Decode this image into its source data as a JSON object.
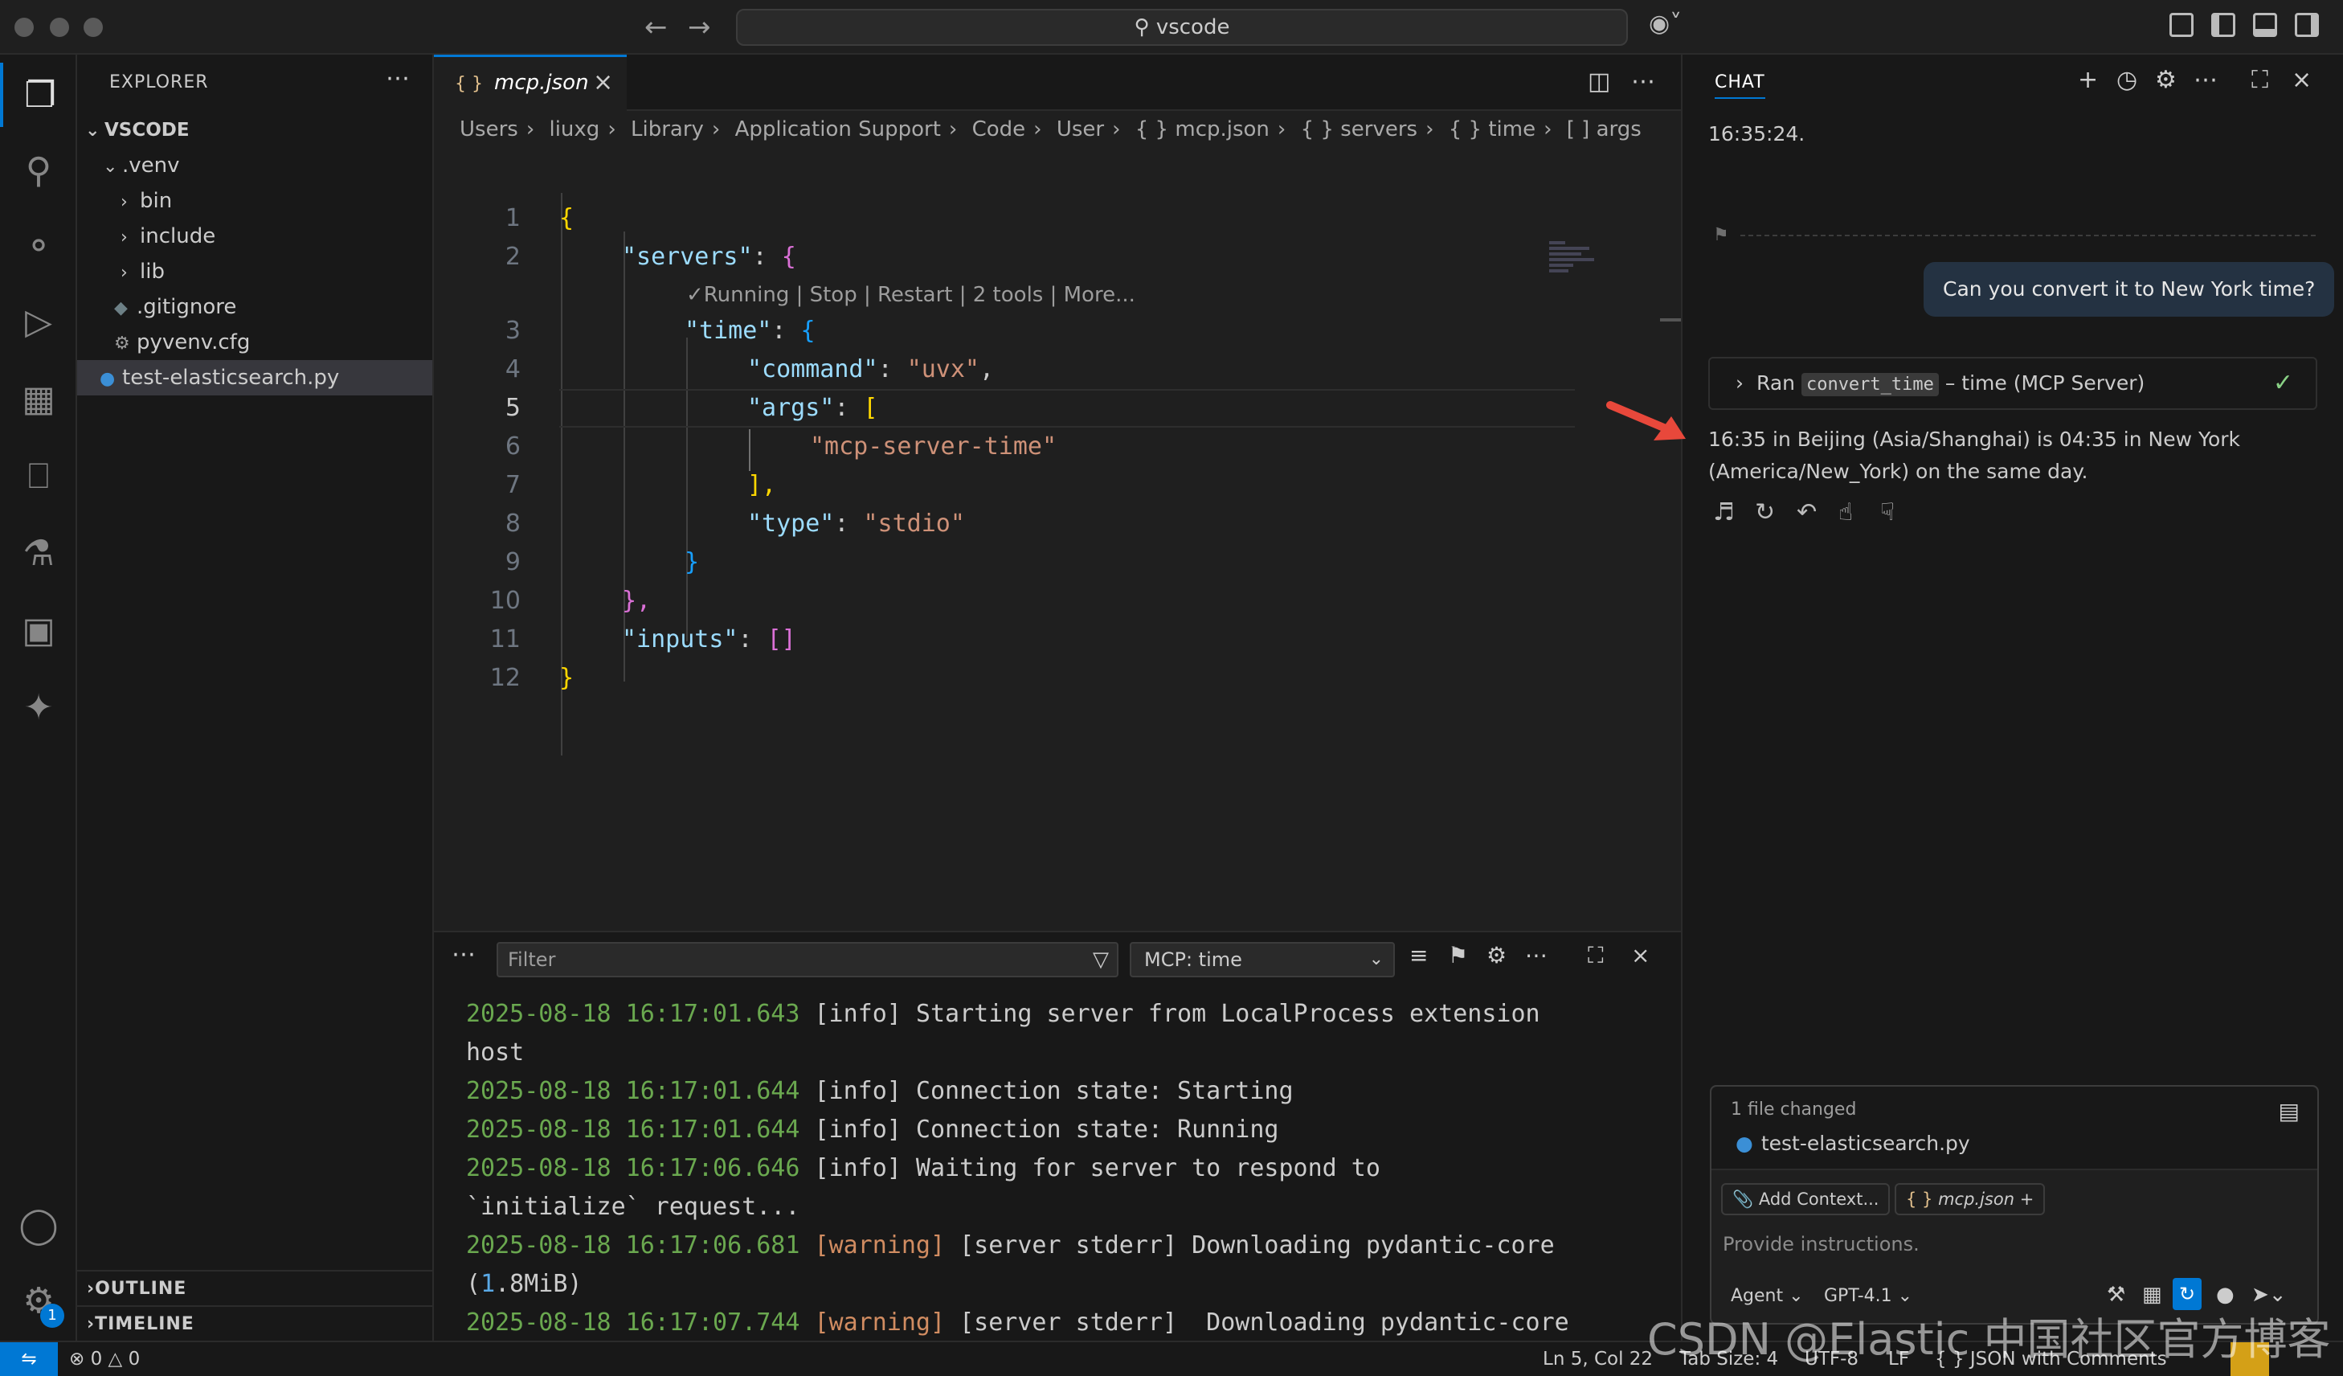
{
  "window": {
    "search_text": "vscode"
  },
  "activity": {
    "accounts_badge": "1"
  },
  "explorer": {
    "title": "EXPLORER",
    "root": "VSCODE",
    "items": [
      {
        "label": ".venv",
        "type": "folder-open",
        "depth": 1
      },
      {
        "label": "bin",
        "type": "folder",
        "depth": 2
      },
      {
        "label": "include",
        "type": "folder",
        "depth": 2
      },
      {
        "label": "lib",
        "type": "folder",
        "depth": 2
      },
      {
        "label": ".gitignore",
        "type": "file",
        "depth": 2
      },
      {
        "label": "pyvenv.cfg",
        "type": "file",
        "depth": 2
      },
      {
        "label": "test-elasticsearch.py",
        "type": "python",
        "depth": 1
      }
    ],
    "outline": "OUTLINE",
    "timeline": "TIMELINE"
  },
  "editor": {
    "tab_label": "mcp.json",
    "tab_icon": "{ }",
    "breadcrumb": [
      "Users",
      "liuxg",
      "Library",
      "Application Support",
      "Code",
      "User",
      "{ } mcp.json",
      "{ } servers",
      "{ } time",
      "[ ] args"
    ],
    "codelens": "✓Running | Stop | Restart | 2 tools | More...",
    "current_line": 5,
    "line_numbers": [
      "1",
      "2",
      "3",
      "4",
      "5",
      "6",
      "7",
      "8",
      "9",
      "10",
      "11",
      "12"
    ],
    "code": {
      "l1": "{",
      "l2_key": "\"servers\"",
      "l2_brace": "{",
      "l3_key": "\"time\"",
      "l3_brace": "{",
      "l4_key": "\"command\"",
      "l4_val": "\"uvx\"",
      "l5_key": "\"args\"",
      "l5_bracket": "[",
      "l6_val": "\"mcp-server-time\"",
      "l7": "],",
      "l8_key": "\"type\"",
      "l8_val": "\"stdio\"",
      "l9": "}",
      "l10": "},",
      "l11_key": "\"inputs\"",
      "l11_val": "[]",
      "l12": "}"
    }
  },
  "panel": {
    "filter_placeholder": "Filter",
    "channel": "MCP: time",
    "log": [
      {
        "ts": "2025-08-18 16:17:01.643",
        "level": "[info]",
        "msg": " Starting server from LocalProcess extension"
      },
      {
        "cont": "host"
      },
      {
        "ts": "2025-08-18 16:17:01.644",
        "level": "[info]",
        "msg": " Connection state: Starting"
      },
      {
        "ts": "2025-08-18 16:17:01.644",
        "level": "[info]",
        "msg": " Connection state: Running"
      },
      {
        "ts": "2025-08-18 16:17:06.646",
        "level": "[info]",
        "msg": " Waiting for server to respond to"
      },
      {
        "cont": "`initialize` request..."
      },
      {
        "ts": "2025-08-18 16:17:06.681",
        "level": "[warning]",
        "msg": " [server stderr] Downloading pydantic-core"
      },
      {
        "cont_open": "(",
        "cont_num": "1",
        "cont_rest": ".8MiB)"
      },
      {
        "ts": "2025-08-18 16:17:07.744",
        "level": "[warning]",
        "msg": " [server stderr]  Downloading pydantic-core"
      }
    ]
  },
  "chat": {
    "title": "CHAT",
    "prev_text": "16:35:24.",
    "user_message": "Can you convert it to New York time?",
    "tool_ran": "Ran",
    "tool_name": "convert_time",
    "tool_source": " – time (MCP Server)",
    "response_line1": "16:35 in Beijing (Asia/Shanghai) is 04:35 in New York",
    "response_line2": "(America/New_York) on the same day.",
    "files_changed": "1 file changed",
    "changed_file": "test-elasticsearch.py",
    "add_context": "Add Context...",
    "context_file": "mcp.json",
    "input_placeholder": "Provide instructions.",
    "mode": "Agent",
    "model": "GPT-4.1"
  },
  "status": {
    "problems": "0",
    "warnings": "0",
    "position": "Ln 5, Col 22",
    "tab_size": "Tab Size: 4",
    "encoding": "UTF-8",
    "eol": "LF",
    "language": "JSON with Comments"
  },
  "watermark": "CSDN @Elastic 中国社区官方博客",
  "colors": {
    "accent": "#0078d4",
    "string": "#ce9178",
    "key": "#9cdcfe",
    "timestamp": "#6aa84f",
    "warning": "#d18c61"
  }
}
